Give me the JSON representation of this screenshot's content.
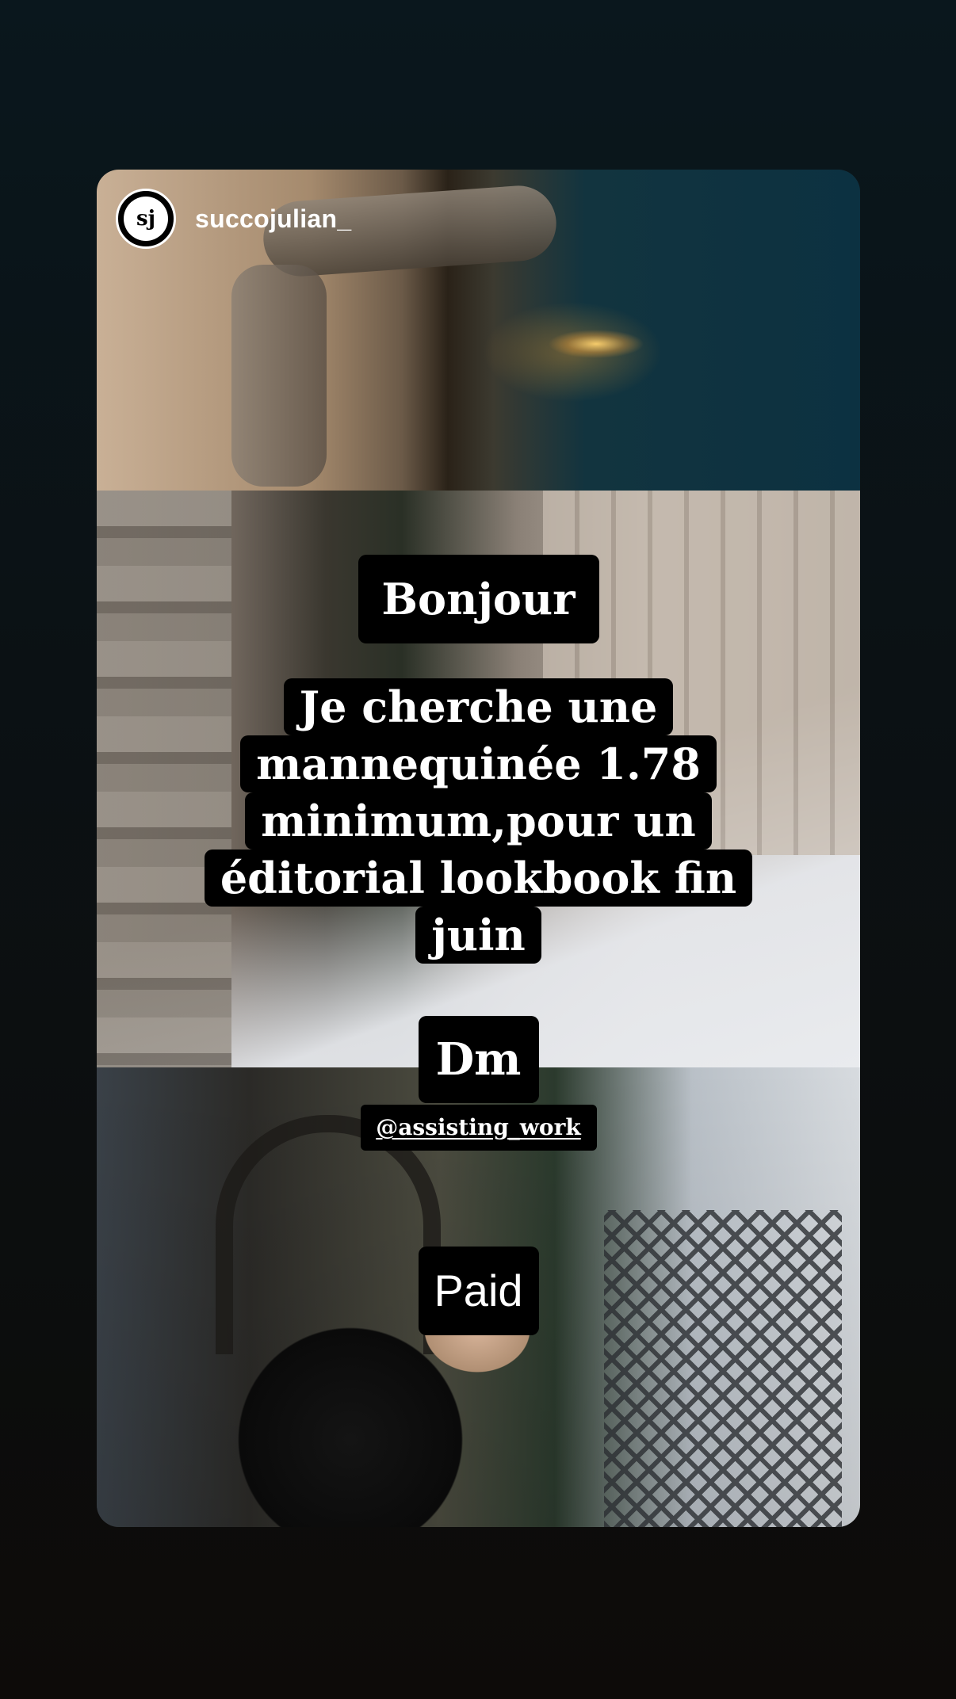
{
  "story": {
    "username": "succojulian_",
    "avatar_text": "sj",
    "stickers": {
      "bonjour": "Bonjour",
      "main": "Je cherche une mannequinée 1.78 minimum,pour un éditorial lookbook fin juin",
      "dm": "Dm",
      "mention": "@assisting_work",
      "paid": "Paid"
    }
  }
}
